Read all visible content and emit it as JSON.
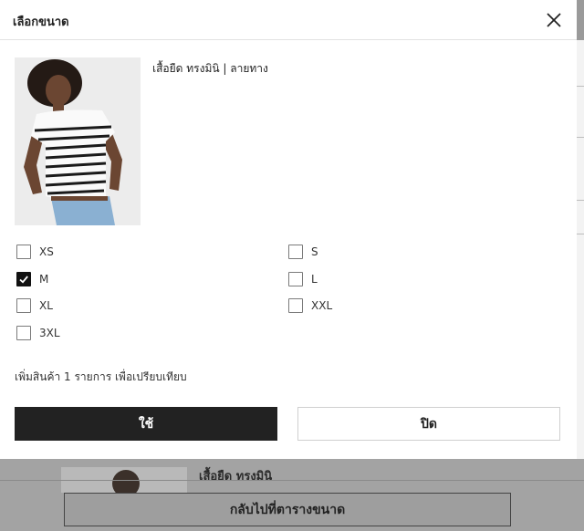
{
  "modal": {
    "title": "เลือกขนาด",
    "product_name": "เสื้อยืด ทรงมินิ | ลายทาง",
    "sizes": [
      {
        "label": "XS",
        "checked": false
      },
      {
        "label": "S",
        "checked": false
      },
      {
        "label": "M",
        "checked": true
      },
      {
        "label": "L",
        "checked": false
      },
      {
        "label": "XL",
        "checked": false
      },
      {
        "label": "XXL",
        "checked": false
      },
      {
        "label": "3XL",
        "checked": false
      }
    ],
    "compare_note": "เพิ่มสินค้า 1 รายการ เพื่อเปรียบเทียบ",
    "apply_label": "ใช้",
    "close_label": "ปิด"
  },
  "background": {
    "product_title": "เสื้อยืด ทรงมินิ",
    "back_button_label": "กลับไปที่ตารางขนาด"
  },
  "colors": {
    "primary_button": "#222222",
    "checkbox_checked": "#111111",
    "overlay": "#9a9a9a"
  }
}
